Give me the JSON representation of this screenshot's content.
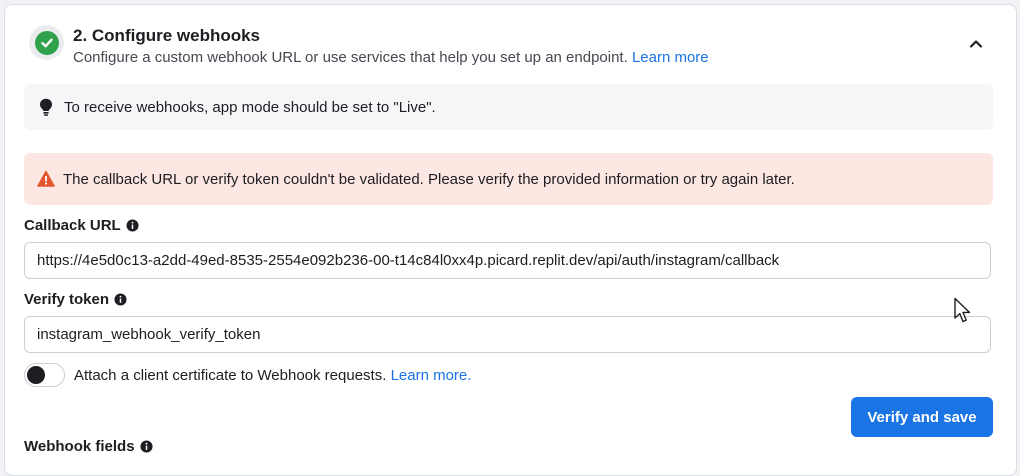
{
  "section": {
    "title": "2. Configure webhooks",
    "subtitle": "Configure a custom webhook URL or use services that help you set up an endpoint.",
    "learn_more": "Learn more"
  },
  "notice": {
    "text": "To receive webhooks, app mode should be set to \"Live\"."
  },
  "error": {
    "text": "The callback URL or verify token couldn't be validated. Please verify the provided information or try again later."
  },
  "callback": {
    "label": "Callback URL",
    "value": "https://4e5d0c13-a2dd-49ed-8535-2554e092b236-00-t14c84l0xx4p.picard.replit.dev/api/auth/instagram/callback"
  },
  "verify": {
    "label": "Verify token",
    "value": "instagram_webhook_verify_token"
  },
  "certificate": {
    "text": "Attach a client certificate to Webhook requests.",
    "learn_more": "Learn more.",
    "enabled": false
  },
  "actions": {
    "verify_save": "Verify and save"
  },
  "webhook_fields": {
    "label": "Webhook fields"
  },
  "colors": {
    "accent": "#1b74e4",
    "success": "#31a24c",
    "error_bg": "#fde7e2",
    "warning": "#e4572e"
  },
  "icons": [
    "check-circle-icon",
    "chevron-up-icon",
    "lightbulb-icon",
    "warning-icon",
    "info-icon",
    "cursor-icon"
  ]
}
